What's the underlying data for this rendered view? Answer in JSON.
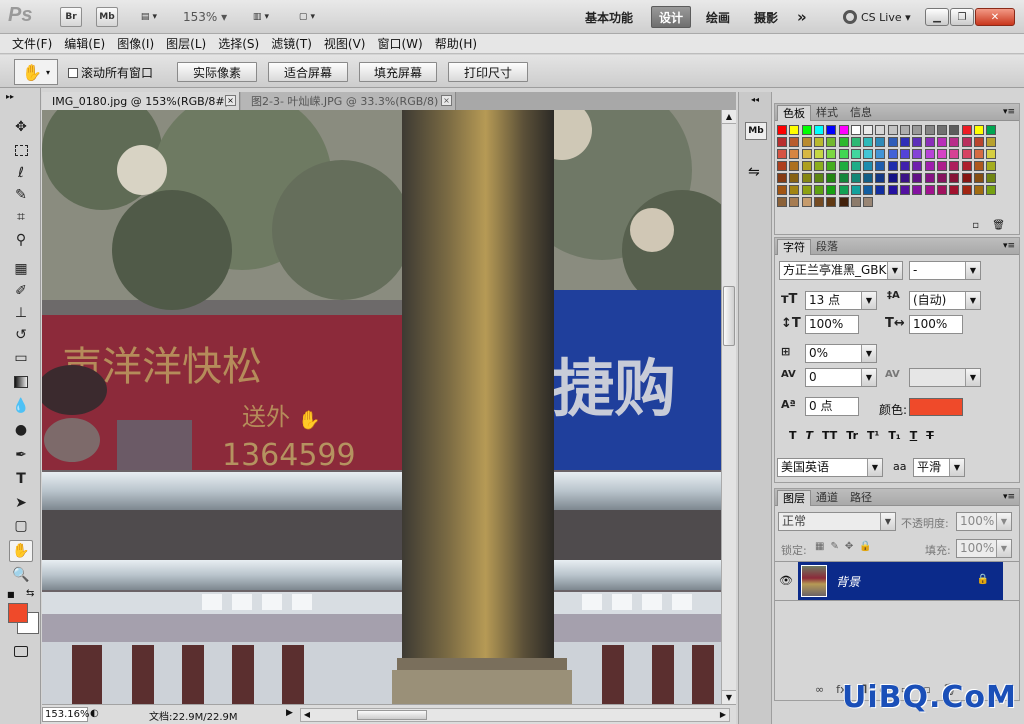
{
  "app": {
    "logo": "Ps",
    "zoom": "153%"
  },
  "appbar": {
    "br_label": "Br",
    "mb_label": "Mb",
    "workspaces": [
      "基本功能",
      "设计",
      "绘画",
      "摄影"
    ],
    "active_workspace": "设计",
    "more": "»",
    "cs_live": "CS Live",
    "cs_live_arrow": "▾"
  },
  "menus": [
    "文件(F)",
    "编辑(E)",
    "图像(I)",
    "图层(L)",
    "选择(S)",
    "滤镜(T)",
    "视图(V)",
    "窗口(W)",
    "帮助(H)"
  ],
  "options": {
    "scroll_all": "滚动所有窗口",
    "buttons": [
      "实际像素",
      "适合屏幕",
      "填充屏幕",
      "打印尺寸"
    ]
  },
  "tabs": [
    {
      "label": "IMG_0180.jpg @ 153%(RGB/8#)",
      "active": true
    },
    {
      "label": "图2-3- 叶灿嵘.JPG @ 33.3%(RGB/8)",
      "active": false
    }
  ],
  "tab_close": "×",
  "status": {
    "zoom": "153.16%",
    "doc": "文档:22.9M/22.9M"
  },
  "photo_text": {
    "red_sign_1": "声洋洋快松",
    "red_sign_2": "送外",
    "red_sign_phone": "1364599",
    "blue_sign": "捷购"
  },
  "swatches_panel": {
    "tabs": [
      "色板",
      "样式",
      "信息"
    ],
    "active": "色板"
  },
  "character_panel": {
    "tabs": [
      "字符",
      "段落"
    ],
    "active": "字符",
    "font_family": "方正兰亭准黑_GBK",
    "font_style": "-",
    "size": "13 点",
    "leading": "(自动)",
    "vscale": "100%",
    "hscale": "100%",
    "tsume": "0%",
    "kerning": "0",
    "tracking": "",
    "baseline": "0 点",
    "color_label": "颜色:",
    "color_value": "#ef4a2a",
    "language": "美国英语",
    "aa_label": "aa",
    "antialias": "平滑",
    "style_buttons": [
      "T",
      "T",
      "TT",
      "Tr",
      "T¹",
      "T₁",
      "T",
      "T"
    ]
  },
  "layers_panel": {
    "tabs": [
      "图层",
      "通道",
      "路径"
    ],
    "active": "图层",
    "blend_mode": "正常",
    "opacity_label": "不透明度:",
    "opacity": "100%",
    "lock_label": "锁定:",
    "fill_label": "填充:",
    "fill": "100%",
    "layer_name": "背景"
  },
  "colors": {
    "foreground": "#ef4a2a",
    "background": "#ffffff",
    "layer_selected": "#0b2a8a"
  },
  "watermark": "UiBQ.CoM"
}
